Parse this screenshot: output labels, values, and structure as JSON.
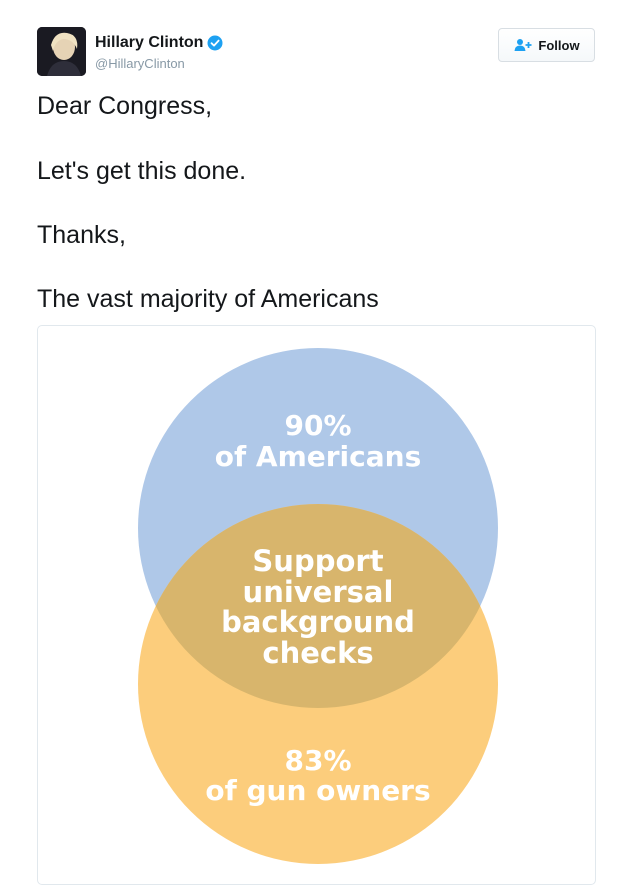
{
  "author": {
    "name": "Hillary Clinton",
    "handle": "@HillaryClinton",
    "verified_color": "#1da1f2"
  },
  "follow_button": {
    "label": "Follow",
    "icon": "add-person-icon"
  },
  "tweet": {
    "lines": [
      "Dear Congress,",
      "Let's get this done.",
      "Thanks,",
      "The vast majority of Americans"
    ]
  },
  "venn": {
    "top_circle": {
      "line1": "90%",
      "line2": "of Americans",
      "color": "#afc8e8"
    },
    "bottom_circle": {
      "line1": "83%",
      "line2": "of gun owners",
      "color": "#fccd7c"
    },
    "overlap": {
      "lines": [
        "Support",
        "universal",
        "background",
        "checks"
      ],
      "color": "#d8b56c"
    }
  }
}
